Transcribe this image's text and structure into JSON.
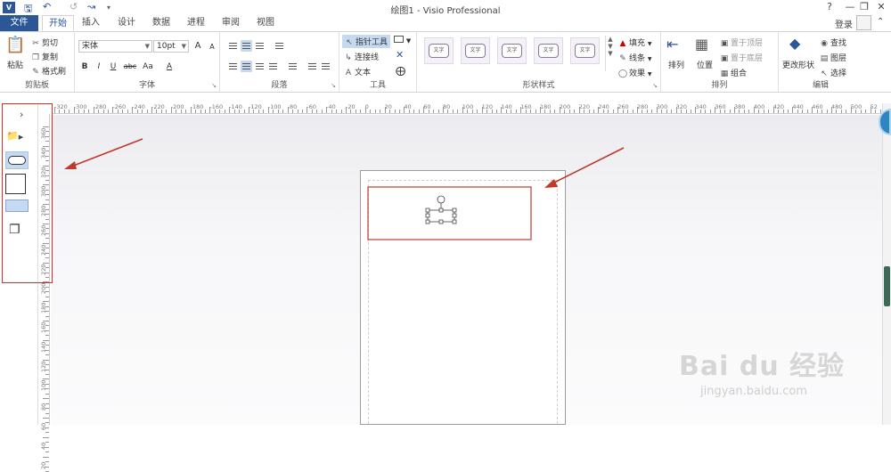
{
  "window": {
    "title": "绘图1 - Visio Professional",
    "help": "?",
    "controls": [
      "—",
      "❐",
      "✕"
    ]
  },
  "tabs": {
    "file": "文件",
    "items": [
      {
        "label": "开始",
        "active": true
      },
      {
        "label": "插入",
        "active": false
      },
      {
        "label": "设计",
        "active": false
      },
      {
        "label": "数据",
        "active": false
      },
      {
        "label": "进程",
        "active": false
      },
      {
        "label": "审阅",
        "active": false
      },
      {
        "label": "视图",
        "active": false
      }
    ],
    "login": "登录"
  },
  "ribbon": {
    "clipboard": {
      "label": "剪贴板",
      "paste": "粘贴",
      "cut": "剪切",
      "copy": "复制",
      "format_painter": "格式刷"
    },
    "font": {
      "label": "字体",
      "font_name": "宋体",
      "font_size": "10pt",
      "bold": "B",
      "italic": "I",
      "underline": "U",
      "strike": "abc",
      "case": "Aa",
      "color": "A",
      "grow": "A",
      "shrink": "A"
    },
    "paragraph": {
      "label": "段落"
    },
    "tools": {
      "label": "工具",
      "pointer": "指针工具",
      "connector": "连接线",
      "text": "文本"
    },
    "shape_styles": {
      "label": "形状样式",
      "swatch_text": "文字",
      "fill": "填充",
      "line": "线条",
      "effects": "效果"
    },
    "arrange": {
      "label": "排列",
      "arrange": "排列",
      "position": "位置",
      "bring_front": "置于顶层",
      "send_back": "置于底层",
      "group": "组合"
    },
    "editing": {
      "label": "编辑",
      "change_shape": "更改形状",
      "find": "查找",
      "layers": "图层",
      "select": "选择"
    }
  },
  "hruler": [
    "-320",
    "-300",
    "-280",
    "-260",
    "-240",
    "-220",
    "-200",
    "-180",
    "-160",
    "-140",
    "-120",
    "-100",
    "-80",
    "-60",
    "-40",
    "-20",
    "0",
    "20",
    "40",
    "60",
    "80",
    "100",
    "120",
    "140",
    "160",
    "180",
    "200",
    "220",
    "240",
    "260",
    "280",
    "300",
    "320",
    "340",
    "360",
    "380",
    "400",
    "420",
    "440",
    "460",
    "480",
    "500",
    "52"
  ],
  "vruler": [
    "360",
    "340",
    "320",
    "300",
    "280",
    "260",
    "240",
    "220",
    "200",
    "180",
    "160",
    "140",
    "120",
    "100",
    "80",
    "60",
    "40",
    "20"
  ],
  "watermark": {
    "logo": "Bai du 经验",
    "sub": "jingyan.baidu.com"
  },
  "colors": {
    "accent": "#2b5797",
    "highlight": "#c0392b",
    "selection": "#c5d9f1"
  }
}
